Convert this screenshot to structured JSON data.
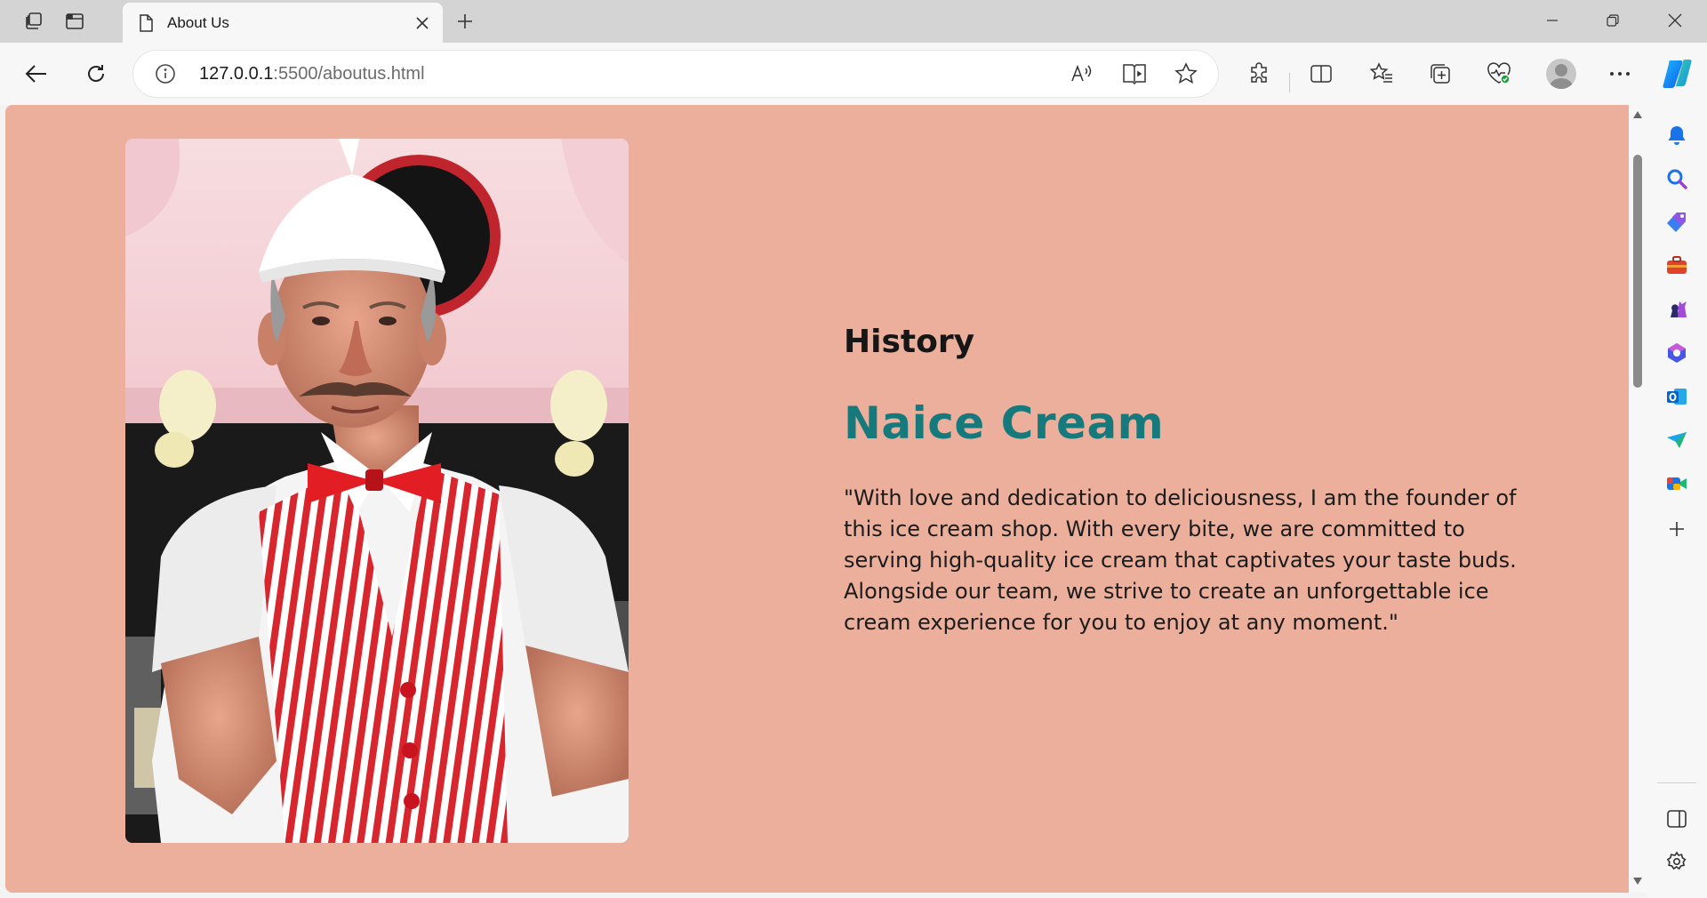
{
  "browser": {
    "tab": {
      "title": "About Us"
    },
    "address": {
      "host": "127.0.0.1",
      "path": ":5500/aboutus.html"
    }
  },
  "page": {
    "section_label": "History",
    "brand_name": "Naice Cream",
    "quote": "\"With love and dedication to deliciousness, I am the founder of this ice cream shop. With every bite, we are committed to serving high-quality ice cream that captivates your taste buds. Alongside our team, we strive to create an unforgettable ice cream experience for you to enjoy at any moment.\""
  },
  "colors": {
    "page_background": "#ecaf9c",
    "brand_teal": "#167a7d",
    "heading_dark": "#161616"
  },
  "icons": {
    "tabbar": [
      "workspaces-icon",
      "tab-actions-icon",
      "page-icon",
      "close-icon",
      "plus-icon",
      "minimize-icon",
      "restore-icon",
      "window-close-icon"
    ],
    "toolbar": [
      "back-arrow-icon",
      "refresh-icon",
      "info-icon",
      "read-aloud-icon",
      "immersive-reader-icon",
      "favorite-star-icon",
      "extensions-icon",
      "split-screen-icon",
      "favorites-icon",
      "collections-icon",
      "browser-essentials-icon",
      "profile-avatar",
      "more-icon",
      "copilot-icon"
    ],
    "sidebar": [
      "notifications-icon",
      "search-icon",
      "shopping-icon",
      "tools-icon",
      "games-icon",
      "microsoft-365-icon",
      "outlook-icon",
      "drop-icon",
      "meet-icon",
      "add-icon",
      "sidebar-toggle-icon",
      "settings-icon"
    ]
  }
}
